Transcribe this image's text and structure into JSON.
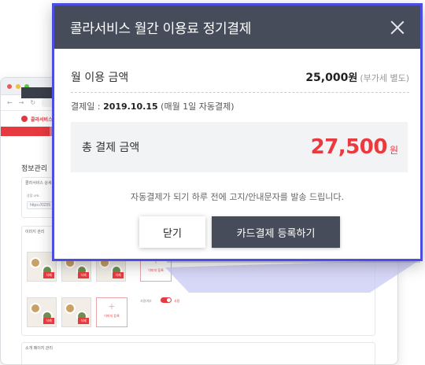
{
  "background_page": {
    "logo_text": "콜라서비스",
    "menu_item": "정보관리",
    "page_title": "정보관리",
    "card1_title": "콜라서비스 상세",
    "url_label": "상점 URL",
    "url_value": "https://0255",
    "image_section_title": "이미지 관리",
    "delete_label": "삭제",
    "add_image_label": "이미지 등록",
    "toggle_label_use": "사용",
    "use_label": "사용여부",
    "intro_section_title": "소개 페이지 관리"
  },
  "modal": {
    "title": "콜라서비스 월간 이용료 정기결제",
    "monthly_label": "월 이용 금액",
    "monthly_amount": "25,000",
    "monthly_unit": "원",
    "vat_note": "(부가세 별도)",
    "pay_date_prefix": "결제일 : ",
    "pay_date": "2019.10.15",
    "pay_date_suffix": " (매월 1일 자동결제)",
    "total_label": "총 결제 금액",
    "total_amount": "27,500",
    "total_unit": "원",
    "notice": "자동결제가 되기 하루 전에 고지/안내문자를 발송 드립니다.",
    "close_button": "닫기",
    "register_button": "카드결제 등록하기"
  },
  "colors": {
    "header_bg": "#464c5a",
    "accent_red": "#e93a3f",
    "modal_border": "#4b4ee0"
  },
  "icons": [
    "close-icon",
    "logo-icon"
  ]
}
